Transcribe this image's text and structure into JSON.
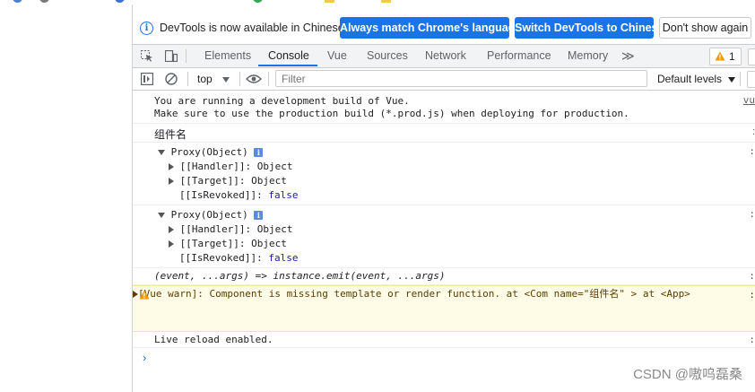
{
  "infobar": {
    "text": "DevTools is now available in Chinese!",
    "btn_match": "Always match Chrome's language",
    "btn_switch": "Switch DevTools to Chinese",
    "btn_dismiss": "Don't show again"
  },
  "tabs": [
    "Elements",
    "Console",
    "Vue",
    "Sources",
    "Network",
    "Performance",
    "Memory"
  ],
  "active_tab": "Console",
  "more_tabs": "≫",
  "warning_count": "1",
  "toolbar": {
    "context": "top",
    "filter_placeholder": "Filter",
    "levels": "Default levels"
  },
  "console": {
    "dev_build_1": "You are running a development build of Vue.",
    "dev_build_2": "Make sure to use the production build (*.prod.js) when deploying for production.",
    "component_name": "组件名",
    "proxy1": {
      "title": "Proxy(Object)",
      "handler_key": "[[Handler]]:",
      "handler_val": "Object",
      "target_key": "[[Target]]:",
      "target_val": "Object",
      "revoked_key": "[[IsRevoked]]:",
      "revoked_val": "false"
    },
    "proxy2": {
      "title": "Proxy(Object)",
      "handler_key": "[[Handler]]:",
      "handler_val": "Object",
      "target_key": "[[Target]]:",
      "target_val": "Object",
      "revoked_key": "[[IsRevoked]]:",
      "revoked_val": "false"
    },
    "emit_fn": "(event, ...args) => instance.emit(event, ...args)",
    "warn_1": "[Vue warn]: Component is missing template or render function.",
    "warn_2": "at <Com name=\"组件名\" >",
    "warn_3": "at <App>",
    "live_reload": "Live reload enabled."
  },
  "watermark": "CSDN @嗷呜磊桑",
  "colors": {
    "accent": "#1a73e8",
    "warning_bg": "#fefbe6",
    "warning_icon": "#f29900"
  }
}
